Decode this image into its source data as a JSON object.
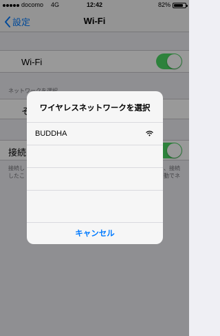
{
  "status_bar": {
    "carrier": "docomo",
    "network": "4G",
    "time": "12:42",
    "battery": "82%",
    "battery_level": 0.82
  },
  "nav": {
    "back_label": "設定",
    "title": "Wi-Fi"
  },
  "settings": {
    "wifi_label": "Wi-Fi",
    "wifi_on": true,
    "network_section_header": "ネットワークを選択",
    "other_label": "そ",
    "ask_to_join_label": "接続を",
    "ask_to_join_on": true,
    "footer_left": "接続し\nしたこ",
    "footer_right": "、接続\n動でネ"
  },
  "alert": {
    "title": "ワイヤレスネットワークを選択",
    "networks": [
      {
        "name": "BUDDHA",
        "icon": "wifi-icon"
      },
      {
        "name": ""
      },
      {
        "name": ""
      },
      {
        "name": ""
      }
    ],
    "cancel_label": "キャンセル"
  },
  "colors": {
    "accent": "#007aff",
    "toggle_on": "#4cd964"
  }
}
